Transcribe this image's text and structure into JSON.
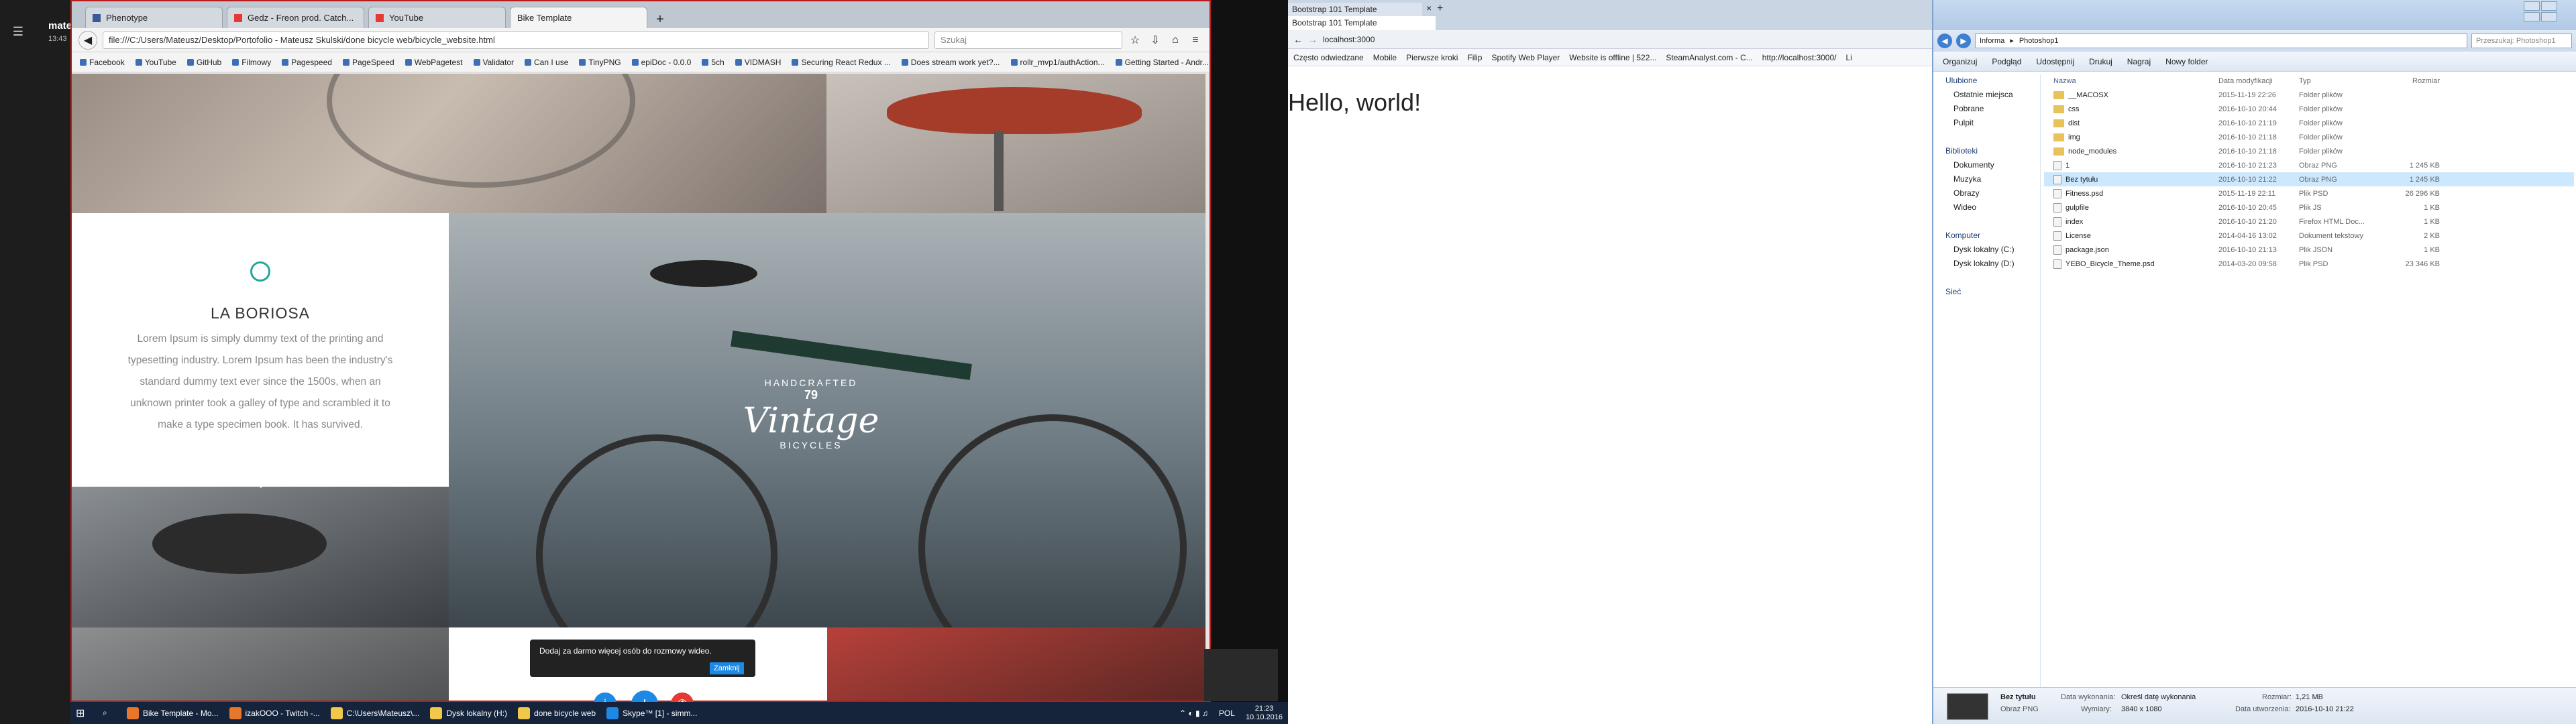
{
  "skype_rail": {
    "user": "mate",
    "time": "13:43"
  },
  "firefox": {
    "tabs": [
      {
        "label": "Phenotype"
      },
      {
        "label": "Gedz - Freon prod. Catch..."
      },
      {
        "label": "YouTube"
      },
      {
        "label": "Bike Template"
      }
    ],
    "url": "file:///C:/Users/Mateusz/Desktop/Portofolio - Mateusz Skulski/done bicycle web/bicycle_website.html",
    "search_placeholder": "Szukaj",
    "bookmarks": [
      "Facebook",
      "YouTube",
      "GitHub",
      "Filmowy",
      "Pagespeed",
      "PageSpeed",
      "WebPagetest",
      "Validator",
      "Can I use",
      "TinyPNG",
      "epiDoc - 0.0.0",
      "5ch",
      "VIDMASH",
      "Securing React Redux ...",
      "Does stream work yet?...",
      "rollr_mvp1/authAction...",
      "Getting Started - Andr..."
    ]
  },
  "site": {
    "card_title": "LA BORIOSA",
    "card_text": "Lorem Ipsum is simply dummy text of the printing and typesetting industry. Lorem Ipsum has been the industry's standard dummy text ever since the 1500s, when an unknown printer took a galley of type and scrambled it to make a type specimen book. It has survived.",
    "logo_top": "HANDCRAFTED",
    "logo_num": "79",
    "logo_main": "Vintage",
    "logo_bottom": "BICYCLES"
  },
  "skype_popup": {
    "text": "Dodaj za darmo więcej osób do rozmowy wideo.",
    "button": "Zamknij"
  },
  "bootstrap_window": {
    "tab_title": "Bootstrap 101 Template",
    "tab_title2": "Bootstrap 101 Template",
    "url": "localhost:3000",
    "heading": "Hello, world!",
    "bookmarks": [
      "Często odwiedzane",
      "Mobile",
      "Pierwsze kroki",
      "Filip",
      "Spotify Web Player",
      "Website is offline | 522...",
      "SteamAnalyst.com - C...",
      "http://localhost:3000/",
      "Li"
    ]
  },
  "explorer": {
    "breadcrumb": [
      "Informa",
      "Photoshop1"
    ],
    "search_placeholder": "Przeszukaj: Photoshop1",
    "commands": [
      "Organizuj",
      "Podgląd",
      "Udostępnij",
      "Drukuj",
      "Nagraj",
      "Nowy folder"
    ],
    "nav": [
      {
        "label": "Ulubione",
        "group": true
      },
      {
        "label": "Ostatnie miejsca"
      },
      {
        "label": "Pobrane"
      },
      {
        "label": "Pulpit"
      },
      {
        "label": "",
        "spacer": true
      },
      {
        "label": "Biblioteki",
        "group": true
      },
      {
        "label": "Dokumenty"
      },
      {
        "label": "Muzyka"
      },
      {
        "label": "Obrazy"
      },
      {
        "label": "Wideo"
      },
      {
        "label": "",
        "spacer": true
      },
      {
        "label": "Komputer",
        "group": true
      },
      {
        "label": "Dysk lokalny (C:)"
      },
      {
        "label": "Dysk lokalny (D:)"
      },
      {
        "label": "",
        "spacer": true
      },
      {
        "label": "Sieć",
        "group": true
      }
    ],
    "columns": [
      "Nazwa",
      "Data modyfikacji",
      "Typ",
      "Rozmiar"
    ],
    "files": [
      {
        "name": "__MACOSX",
        "date": "2015-11-19 22:26",
        "type": "Folder plików",
        "size": "",
        "folder": true
      },
      {
        "name": "css",
        "date": "2016-10-10 20:44",
        "type": "Folder plików",
        "size": "",
        "folder": true
      },
      {
        "name": "dist",
        "date": "2016-10-10 21:19",
        "type": "Folder plików",
        "size": "",
        "folder": true
      },
      {
        "name": "img",
        "date": "2016-10-10 21:18",
        "type": "Folder plików",
        "size": "",
        "folder": true
      },
      {
        "name": "node_modules",
        "date": "2016-10-10 21:18",
        "type": "Folder plików",
        "size": "",
        "folder": true
      },
      {
        "name": "1",
        "date": "2016-10-10 21:23",
        "type": "Obraz PNG",
        "size": "1 245 KB",
        "folder": false
      },
      {
        "name": "Bez tytułu",
        "date": "2016-10-10 21:22",
        "type": "Obraz PNG",
        "size": "1 245 KB",
        "folder": false,
        "selected": true
      },
      {
        "name": "Fitness.psd",
        "date": "2015-11-19 22:11",
        "type": "Plik PSD",
        "size": "26 296 KB",
        "folder": false
      },
      {
        "name": "gulpfile",
        "date": "2016-10-10 20:45",
        "type": "Plik JS",
        "size": "1 KB",
        "folder": false
      },
      {
        "name": "index",
        "date": "2016-10-10 21:20",
        "type": "Firefox HTML Doc...",
        "size": "1 KB",
        "folder": false
      },
      {
        "name": "License",
        "date": "2014-04-16 13:02",
        "type": "Dokument tekstowy",
        "size": "2 KB",
        "folder": false
      },
      {
        "name": "package.json",
        "date": "2016-10-10 21:13",
        "type": "Plik JSON",
        "size": "1 KB",
        "folder": false
      },
      {
        "name": "YEBO_Bicycle_Theme.psd",
        "date": "2014-03-20 09:58",
        "type": "Plik PSD",
        "size": "23 346 KB",
        "folder": false
      }
    ],
    "details": {
      "name": "Bez tytułu",
      "kind": "Obraz PNG",
      "taken_label": "Data wykonania:",
      "taken_value": "Określ datę wykonania",
      "dims_label": "Wymiary:",
      "dims_value": "3840 x 1080",
      "size_label": "Rozmiar:",
      "size_value": "1,21 MB",
      "created_label": "Data utworzenia:",
      "created_value": "2016-10-10 21:22"
    }
  },
  "taskbar": {
    "items": [
      "Bike Template - Mo...",
      "izakOOO - Twitch -...",
      "C:\\Users\\Mateusz\\...",
      "Dysk lokalny (H:)",
      "done bicycle web",
      "Skype™ [1] - simm..."
    ],
    "lang": "POL",
    "time": "21:23",
    "date": "10.10.2016"
  },
  "colors": {
    "accent": "#26a69a",
    "dark": "#333333"
  }
}
